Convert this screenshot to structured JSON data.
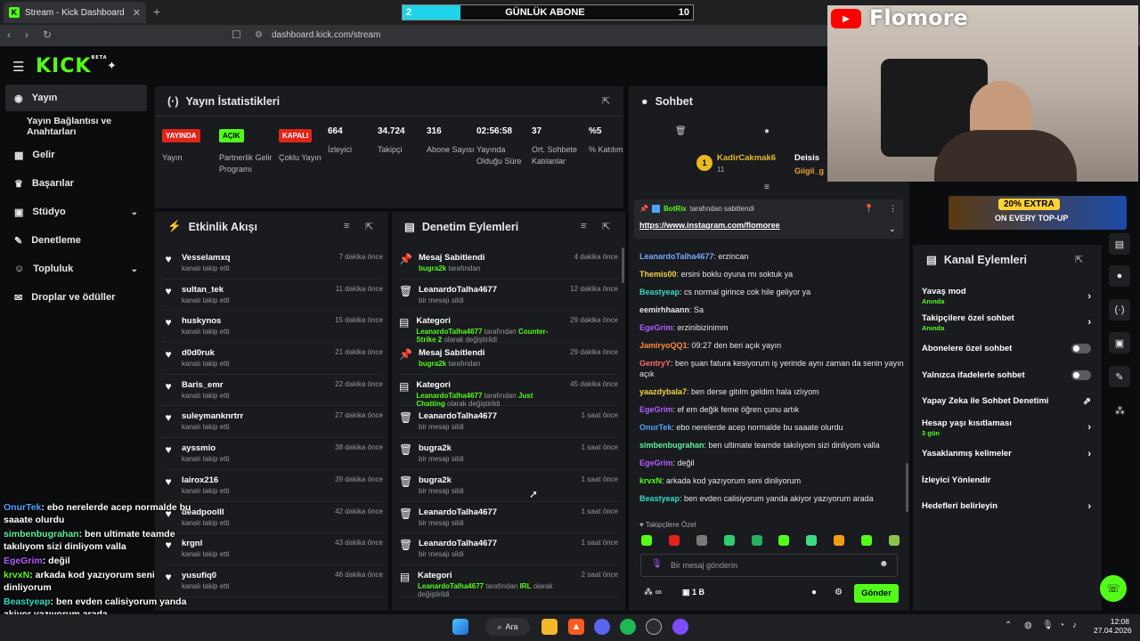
{
  "browser": {
    "tab_title": "Stream - Kick Dashboard",
    "url": "dashboard.kick.com/stream"
  },
  "subgoal": {
    "title": "GÜNLÜK ABONE",
    "current": "2",
    "target": "10",
    "progress": 0.2
  },
  "kick": {
    "logo": "KICK",
    "beta": "BETA"
  },
  "sidebar": {
    "items": [
      {
        "label": "Yayın",
        "icon": "broadcast-icon"
      },
      {
        "label": "Yayın Bağlantısı ve Anahtarları"
      },
      {
        "label": "Gelir",
        "icon": "chart-icon"
      },
      {
        "label": "Başarılar",
        "icon": "trophy-icon"
      },
      {
        "label": "Stüdyo",
        "icon": "studio-icon"
      },
      {
        "label": "Denetleme",
        "icon": "wrench-icon"
      },
      {
        "label": "Topluluk",
        "icon": "community-icon"
      },
      {
        "label": "Droplar ve ödüller",
        "icon": "gift-icon"
      }
    ]
  },
  "stats": {
    "title": "Yayın İstatistikleri",
    "cols": [
      {
        "value": "YAYINDA",
        "label": "Yayın",
        "badge_color": "#e1251b"
      },
      {
        "value": "AÇIK",
        "label": "Partnerlik Gelir Programı",
        "badge_color": "#53fc18"
      },
      {
        "value": "KAPALI",
        "label": "Çoklu Yayın",
        "badge_color": "#e1251b"
      },
      {
        "value": "664",
        "label": "İzleyici"
      },
      {
        "value": "34.724",
        "label": "Takipçi"
      },
      {
        "value": "316",
        "label": "Abone Sayısı"
      },
      {
        "value": "02:56:58",
        "label": "Yayında Olduğu Süre"
      },
      {
        "value": "37",
        "label": "Ort. Sohbete Katılanlar"
      },
      {
        "value": "%5",
        "label": "% Katılım"
      }
    ]
  },
  "activity": {
    "title": "Etkinlik Akışı",
    "items": [
      {
        "name": "Vesselamxq",
        "sub": "kanalı takip etti",
        "time": "7 dakika önce"
      },
      {
        "name": "sultan_tek",
        "sub": "kanalı takip etti",
        "time": "11 dakika önce"
      },
      {
        "name": "huskynos",
        "sub": "kanalı takip etti",
        "time": "15 dakika önce"
      },
      {
        "name": "d0d0ruk",
        "sub": "kanalı takip etti",
        "time": "21 dakika önce"
      },
      {
        "name": "Baris_emr",
        "sub": "kanalı takip etti",
        "time": "22 dakika önce"
      },
      {
        "name": "suleymanknrtrr",
        "sub": "kanalı takip etti",
        "time": "27 dakika önce"
      },
      {
        "name": "ayssmio",
        "sub": "kanalı takip etti",
        "time": "38 dakika önce"
      },
      {
        "name": "lairox216",
        "sub": "kanalı takip etti",
        "time": "39 dakika önce"
      },
      {
        "name": "deadpoolll",
        "sub": "kanalı takip etti",
        "time": "42 dakika önce"
      },
      {
        "name": "krgnl",
        "sub": "kanalı takip etti",
        "time": "43 dakika önce"
      },
      {
        "name": "yusufiq0",
        "sub": "kanalı takip etti",
        "time": "46 dakika önce"
      }
    ]
  },
  "moderation": {
    "title": "Denetim Eylemleri",
    "items": [
      {
        "icon": "pin-icon",
        "name": "Mesaj Sabitlendi",
        "user": "bugra2k",
        "sub": "tarafından",
        "time": "4 dakika önce"
      },
      {
        "icon": "trash-icon",
        "name": "LeanardoTalha4677",
        "user": "",
        "sub": "bir mesajı sildi",
        "time": "12 dakika önce"
      },
      {
        "icon": "category-icon",
        "name": "Kategori",
        "user": "LeanardoTalha4677",
        "sub": "tarafından",
        "game": "Counter-Strike 2",
        "sub2": "olarak değiştirildi",
        "time": "29 dakika önce"
      },
      {
        "icon": "pin-icon",
        "name": "Mesaj Sabitlendi",
        "user": "bugra2k",
        "sub": "tarafından",
        "time": "29 dakika önce"
      },
      {
        "icon": "category-icon",
        "name": "Kategori",
        "user": "LeanardoTalha4677",
        "sub": "tarafından",
        "game": "Just Chatting",
        "sub2": "olarak değiştirildi",
        "time": "45 dakika önce"
      },
      {
        "icon": "trash-icon",
        "name": "LeanardoTalha4677",
        "user": "",
        "sub": "bir mesajı sildi",
        "time": "1 saat önce"
      },
      {
        "icon": "trash-icon",
        "name": "bugra2k",
        "user": "",
        "sub": "bir mesajı sildi",
        "time": "1 saat önce"
      },
      {
        "icon": "trash-icon",
        "name": "bugra2k",
        "user": "",
        "sub": "bir mesajı sildi",
        "time": "1 saat önce"
      },
      {
        "icon": "trash-icon",
        "name": "LeanardoTalha4677",
        "user": "",
        "sub": "bir mesajı sildi",
        "time": "1 saat önce"
      },
      {
        "icon": "trash-icon",
        "name": "LeanardoTalha4677",
        "user": "",
        "sub": "bir mesajı sildi",
        "time": "1 saat önce"
      },
      {
        "icon": "category-icon",
        "name": "Kategori",
        "user": "LeanardoTalha4677",
        "sub": "tarafından",
        "game": "IRL",
        "sub2": "olarak değiştirildi",
        "time": "2 saat önce"
      }
    ]
  },
  "chat": {
    "title": "Sohbet",
    "top_user": "KadirCakmak6",
    "top_user_count": "11",
    "top_badge": "1",
    "second_user": "Deisis",
    "third_user": "Giigii_g",
    "pinned_by": "BotRix",
    "pinned_by_suffix": "tarafından sabitlendi",
    "pinned_link": "https://www.instagram.com/flomoree",
    "messages": [
      {
        "user": "LeanardoTalha4677",
        "color": "#7aa7ff",
        "text": ": erzincan"
      },
      {
        "user": "Themis00",
        "color": "#f5d142",
        "text": ": ersini boklu oyuna mı soktuk ya"
      },
      {
        "user": "Beastyeap",
        "color": "#34d9c3",
        "text": ": cs normal girince cok hile geliyor ya"
      },
      {
        "user": "eemirhhaann",
        "color": "#e8e8e8",
        "text": ": Sa"
      },
      {
        "user": "EgeGrim",
        "color": "#b45cff",
        "text": ": erzinibizinimm"
      },
      {
        "user": "JamiryoQQ1",
        "color": "#ff8a3d",
        "text": ": 09:27 den beri açık yayın"
      },
      {
        "user": "GentryY",
        "color": "#ff6b6b",
        "text": ": ben şuan fatura kesiyorum iş yerinde aynı zaman da senin yayın açık"
      },
      {
        "user": "yaazdybala7",
        "color": "#f5d142",
        "text": ": ben derse gitılm geldim hala ızlıyom"
      },
      {
        "user": "EgeGrim",
        "color": "#b45cff",
        "text": ": ef em değik feme öğren çunu artık"
      },
      {
        "user": "OnurTek",
        "color": "#4fa3ff",
        "text": ": ebo nerelerde acep normalde bu saaate olurdu"
      },
      {
        "user": "simbenbugrahan",
        "color": "#5df2a0",
        "text": ": ben ultimate teamde takılıyom sizi dinliyom valla"
      },
      {
        "user": "EgeGrim",
        "color": "#b45cff",
        "text": ": değil"
      },
      {
        "user": "krvxN",
        "color": "#53fc18",
        "text": ": arkada kod yazıyorum seni dinliyorum"
      },
      {
        "user": "Beastyeap",
        "color": "#34d9c3",
        "text": ": ben evden calisiyorum yanda akiyor yazıyorum arada"
      }
    ],
    "followers_only": "Takipçilere Özel",
    "input_placeholder": "Bir mesaj gönderin",
    "bits": "1 B",
    "send_label": "Gönder"
  },
  "channel_actions": {
    "title": "Kanal Eylemleri",
    "items": [
      {
        "label": "Yavaş mod",
        "sub": "Anında",
        "kind": "arrow"
      },
      {
        "label": "Takipçilere özel sohbet",
        "sub": "Anında",
        "kind": "arrow"
      },
      {
        "label": "Abonelere özel sohbet",
        "sub": "",
        "kind": "toggle"
      },
      {
        "label": "Yalnızca ifadelerle sohbet",
        "sub": "",
        "kind": "toggle"
      },
      {
        "label": "Yapay Zeka ile Sohbet Denetimi",
        "sub": "",
        "kind": "external"
      },
      {
        "label": "Hesap yaşı kısıtlaması",
        "sub": "3 gün",
        "kind": "arrow"
      },
      {
        "label": "Yasaklanmış kelimeler",
        "sub": "",
        "kind": "arrow"
      },
      {
        "label": "İzleyici Yönlendir",
        "sub": "",
        "kind": "none"
      },
      {
        "label": "Hedefleri belirleyin",
        "sub": "",
        "kind": "arrow"
      }
    ]
  },
  "overlay": {
    "brand": "Flomore",
    "promo": "20% EXTRA",
    "promo_sub": "ON EVERY TOP-UP",
    "chat": [
      {
        "user": "OnurTek",
        "color": "#4fa3ff",
        "text": ": ebo nerelerde acep normalde bu saaate olurdu"
      },
      {
        "user": "simbenbugrahan",
        "color": "#5df2a0",
        "text": ": ben ultimate teamde takılıyom sizi dinliyom valla"
      },
      {
        "user": "EgeGrim",
        "color": "#b45cff",
        "text": ": değil"
      },
      {
        "user": "krvxN",
        "color": "#53fc18",
        "text": ": arkada kod yazıyorum seni dinliyorum"
      },
      {
        "user": "Beastyeap",
        "color": "#34d9c3",
        "text": ": ben evden calisiyorum yanda akiyor yazıyorum arada"
      }
    ]
  },
  "taskbar": {
    "search": "Ara",
    "time": "12:08",
    "date": "27.04.2026"
  }
}
